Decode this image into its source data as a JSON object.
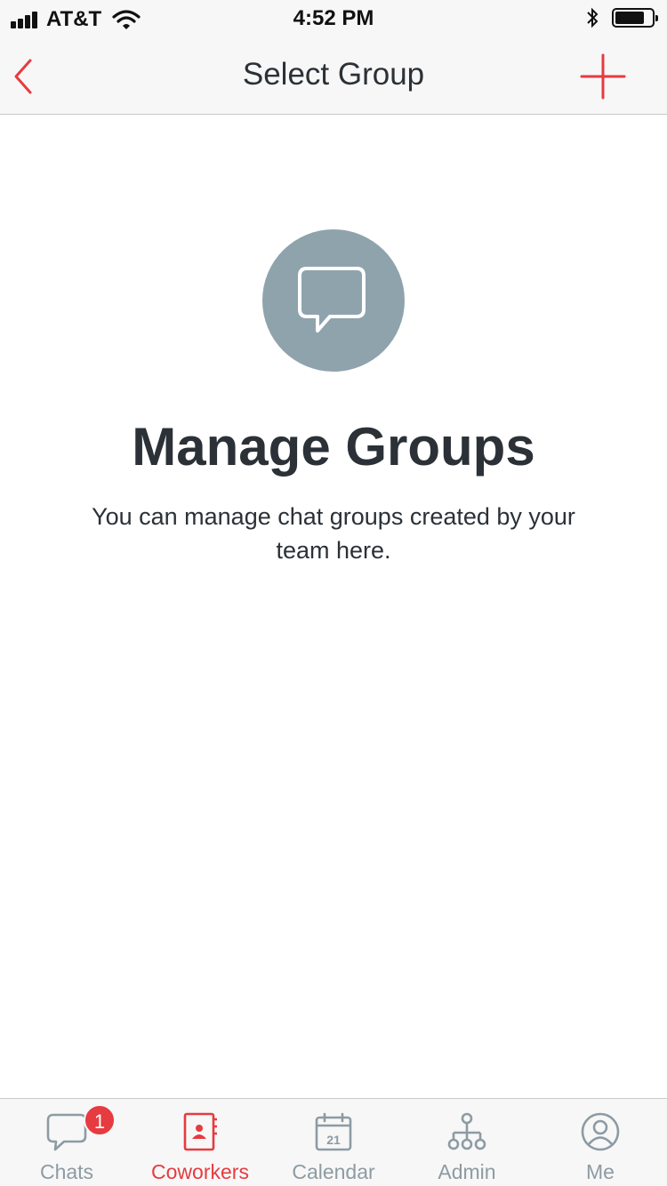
{
  "status_bar": {
    "carrier": "AT&T",
    "time": "4:52 PM",
    "battery_level": 0.8,
    "icons": [
      "signal-icon",
      "wifi-icon",
      "bluetooth-icon",
      "battery-icon"
    ]
  },
  "nav": {
    "title": "Select Group",
    "back_icon": "chevron-left-icon",
    "add_icon": "plus-icon"
  },
  "empty_state": {
    "icon": "chat-bubble-icon",
    "title": "Manage Groups",
    "description": "You can manage chat groups created by your team here."
  },
  "tabs": [
    {
      "label": "Chats",
      "icon": "chat-icon",
      "badge": "1",
      "active": false
    },
    {
      "label": "Coworkers",
      "icon": "contacts-icon",
      "active": true
    },
    {
      "label": "Calendar",
      "icon": "calendar-icon",
      "icon_text": "21",
      "active": false
    },
    {
      "label": "Admin",
      "icon": "org-chart-icon",
      "active": false
    },
    {
      "label": "Me",
      "icon": "profile-icon",
      "active": false
    }
  ],
  "colors": {
    "accent": "#e63b40",
    "inactive": "#8d9ba3",
    "icon_circle": "#8fa3ad",
    "text": "#2b3137"
  }
}
